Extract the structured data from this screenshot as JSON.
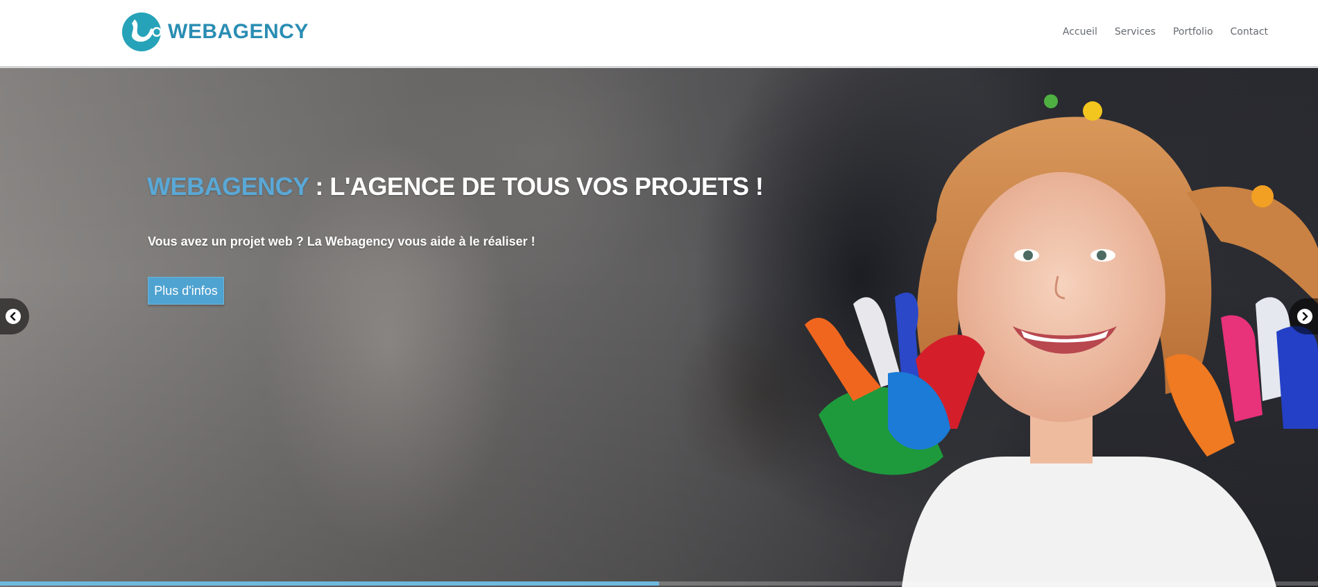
{
  "header": {
    "logo_text": "WEBAGENCY",
    "logo_icon": "webagency-logo-icon",
    "brand_color": "#2a8db3",
    "nav": [
      {
        "label": "Accueil"
      },
      {
        "label": "Services"
      },
      {
        "label": "Portfolio"
      },
      {
        "label": "Contact"
      }
    ]
  },
  "hero": {
    "title_brand": "WEBAGENCY",
    "title_rest": " : L'AGENCE DE TOUS VOS PROJETS !",
    "subtitle": "Vous avez un projet web ? La Webagency vous aide à le réaliser !",
    "button_label": "Plus d'infos",
    "accent_color": "#4fa3d1",
    "prev_icon": "chevron-left-icon",
    "next_icon": "chevron-right-icon",
    "slide_progress": 0.5
  }
}
